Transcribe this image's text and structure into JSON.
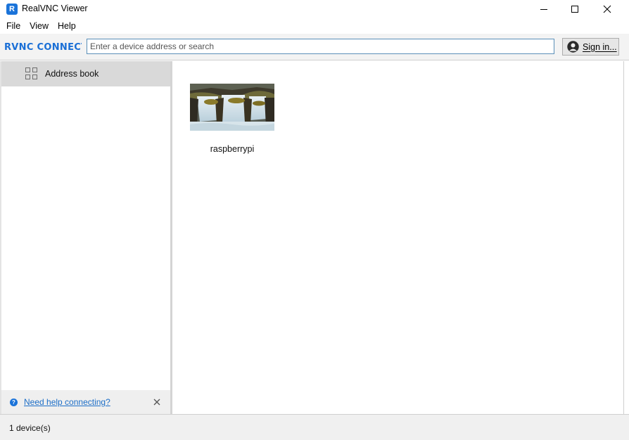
{
  "window": {
    "title": "RealVNC Viewer",
    "app_icon": "realvnc-logo-icon"
  },
  "menu": [
    "File",
    "View",
    "Help"
  ],
  "toolbar": {
    "logo_text": "RVNC CONNECT",
    "search_placeholder": "Enter a device address or search",
    "search_value": "",
    "signin_label": "Sign in..."
  },
  "sidebar": {
    "items": [
      {
        "label": "Address book",
        "icon": "grid-icon",
        "selected": true
      }
    ],
    "help_link": "Need help connecting?"
  },
  "devices": [
    {
      "name": "raspberrypi",
      "thumbnail": "waterfall-image"
    }
  ],
  "status": {
    "text": "1 device(s)"
  },
  "colors": {
    "accent": "#1a73d9",
    "link": "#1c6ec7",
    "selected_item_bg": "#d9d9d9"
  }
}
